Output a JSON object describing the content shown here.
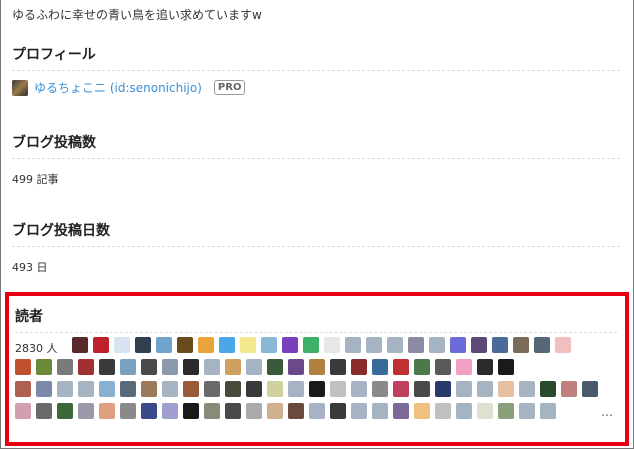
{
  "tagline": "ゆるふわに幸せの青い鳥を追い求めていますw",
  "profile": {
    "heading": "プロフィール",
    "user_name": "ゆるちょこニ (id:senonichijo)",
    "badge": "PRO"
  },
  "posts": {
    "heading": "ブログ投稿数",
    "value": "499 記事"
  },
  "post_days": {
    "heading": "ブログ投稿日数",
    "value": "493 日"
  },
  "readers": {
    "heading": "読者",
    "count": "2830 人",
    "more": "…",
    "highlight_color": "#e60012",
    "icon_rows": [
      [
        "#5a2a2a",
        "#c0202c",
        "#d7e4ef",
        "#2f3f4f",
        "#6fa4cf",
        "#6b4a1c",
        "#e9a53b",
        "#4aa8e8",
        "#f4e88c",
        "#8ab7d6",
        "#7a3fbf",
        "#3fb06a",
        "#e7e7e7",
        "#a5b3c2",
        "#a5b3c2",
        "#a5b3c2",
        "#8a8aa5",
        "#a5b3c2",
        "#6a6ad8",
        "#5b4a7a",
        "#4a6a9a",
        "#7b6b5b",
        "#556677",
        "#f0c0c0"
      ],
      [
        "#c05030",
        "#6a8a3a",
        "#7a7a7a",
        "#a03030",
        "#3a3a3a",
        "#7aa0c0",
        "#4a4a4a",
        "#8a9aaa",
        "#2a2a2a",
        "#a5b3c2",
        "#d0a060",
        "#a5b3c2",
        "#3a5a3a",
        "#6a4a8a",
        "#b08040",
        "#3a3a3a",
        "#8a2a2a",
        "#3a6a9a",
        "#c03030",
        "#4a7a4a",
        "#5a5a5a",
        "#f0a0c0",
        "#2a2a2a",
        "#1a1a1a"
      ],
      [
        "#b06050",
        "#7a8aaa",
        "#a5b3c2",
        "#a5b3c2",
        "#8ab0d0",
        "#5a6a7a",
        "#9a7a5a",
        "#a5b3c2",
        "#9a5a3a",
        "#6a6a6a",
        "#4a4a3a",
        "#3a3a3a",
        "#d0d0a0",
        "#a5b3c2",
        "#1a1a1a",
        "#c0c0c0",
        "#a5b3c2",
        "#8a8a8a",
        "#c04060",
        "#4a4a4a",
        "#2a3a6a",
        "#a5b3c2",
        "#a5b3c2",
        "#e8c0a0",
        "#a5b3c2",
        "#2a4a2a",
        "#c08080",
        "#4a5a6a",
        "#a5b3c2",
        "#a5b3c2"
      ],
      [
        "#d0a0b0",
        "#6a6a6a",
        "#3a6a3a",
        "#9a9aaa",
        "#e0a080",
        "#8a8a8a",
        "#3a4a8a",
        "#a0a0d0",
        "#1a1a1a",
        "#8a8a7a",
        "#4a4a4a",
        "#aaaaaa",
        "#d0b090",
        "#6a4a3a",
        "#a5b3c2",
        "#3a3a3a",
        "#a5b3c2",
        "#a5b3c2",
        "#7a6a9a",
        "#f0c080",
        "#c0c0c0",
        "#a5b3c2",
        "#e0e0d0",
        "#8aa07a",
        "#a5b3c2",
        "#a5b3c2"
      ]
    ]
  }
}
